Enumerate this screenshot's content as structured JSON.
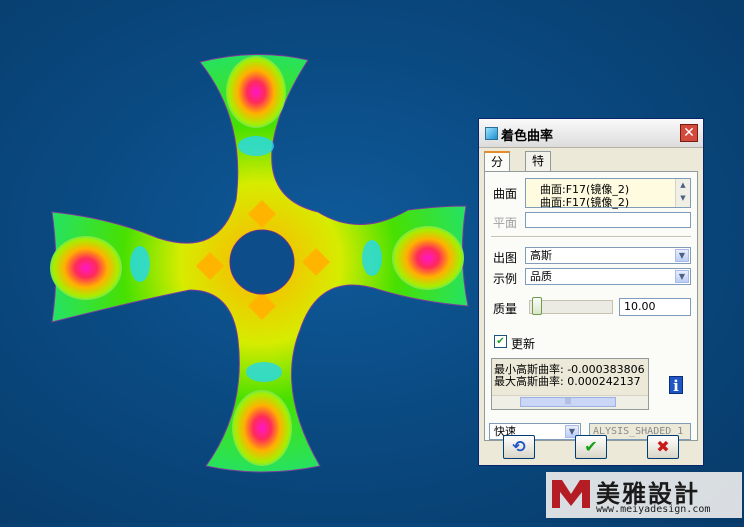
{
  "dialog": {
    "title": "着色曲率",
    "tabs": [
      {
        "label": "分析",
        "active": true
      },
      {
        "label": "特征",
        "active": false
      }
    ],
    "surface_label": "曲面",
    "surface_items": [
      "曲面:F17(镜像_2)",
      "曲面:F17(镜像_2)"
    ],
    "plane_label": "平面",
    "plane_value": "",
    "output_label": "出图",
    "output_value": "高斯",
    "display_label": "示例",
    "display_value": "品质",
    "quality_label": "质量",
    "quality_value": "10.00",
    "quality_fraction": 0.05,
    "update_label": "更新",
    "update_checked": true,
    "results": [
      "最小高斯曲率: -0.000383806",
      "最大高斯曲率: 0.000242137"
    ],
    "mode_value": "快速",
    "analysis_name": "ALYSIS_SHADED_1"
  },
  "colors": {
    "accent": "#e68b2c",
    "close": "#d24b3d",
    "viewport_bg": "#0a4a82"
  },
  "icons": {
    "close": "close-icon",
    "repeat": "repeat-icon",
    "ok": "check-icon",
    "cancel": "cancel-icon",
    "info": "info-icon"
  },
  "watermark": {
    "name": "美雅設計",
    "url": "www.meiyadesign.com"
  }
}
